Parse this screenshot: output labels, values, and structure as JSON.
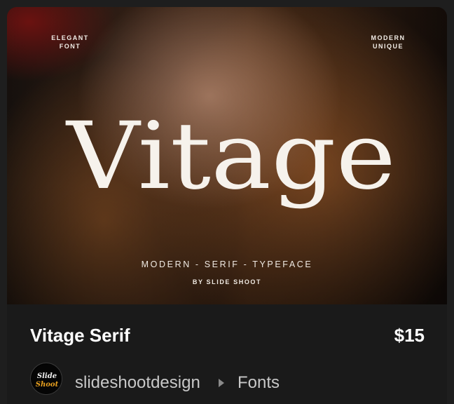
{
  "product": {
    "title": "Vitage Serif",
    "price": "$15",
    "author": "slideshootdesign",
    "category": "Fonts"
  },
  "preview": {
    "corner_left_line1": "ELEGANT",
    "corner_left_line2": "FONT",
    "corner_right_line1": "MODERN",
    "corner_right_line2": "UNIQUE",
    "wordmark": "Vitage",
    "tagline": "MODERN - SERIF - TYPEFACE",
    "byline": "BY SLIDE SHOOT"
  },
  "avatar": {
    "line1": "Slide",
    "line2": "Shoot"
  },
  "icons": {
    "separator": "chevron-right-icon"
  },
  "colors": {
    "background": "#1e1e1e",
    "card": "#1a1a1a",
    "title_text": "#ffffff",
    "meta_text": "#c8c8c8",
    "avatar_accent": "#e8a020"
  }
}
